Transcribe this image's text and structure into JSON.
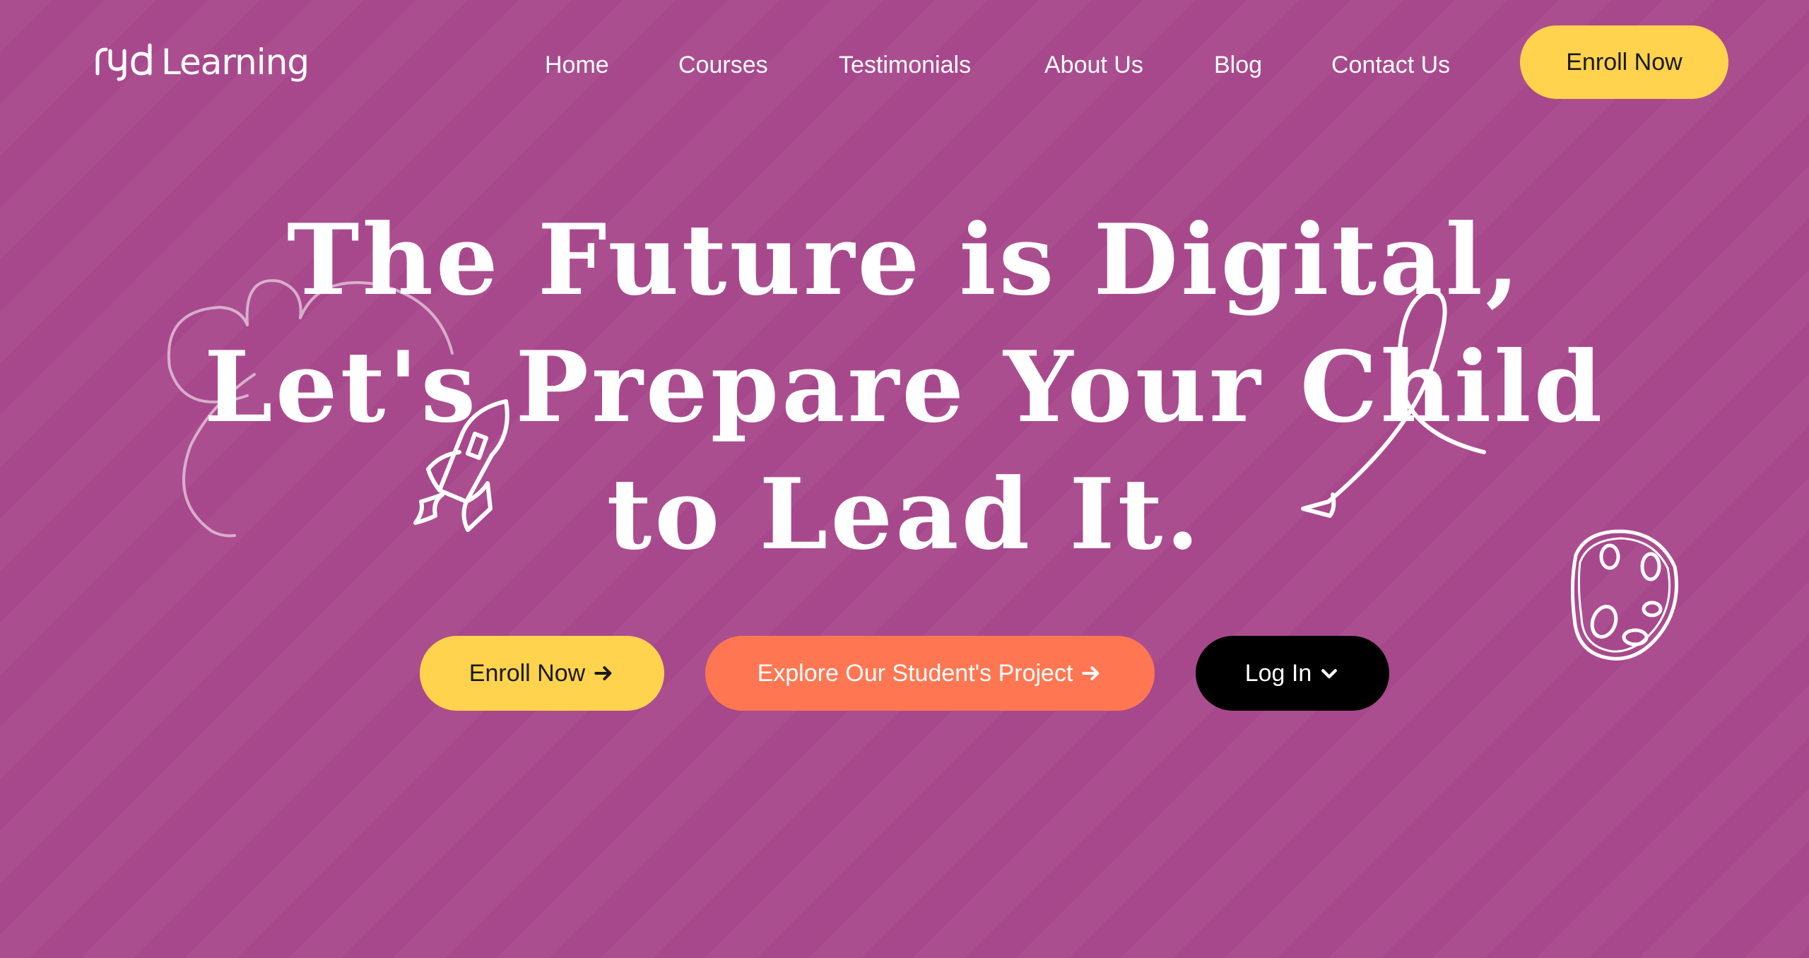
{
  "brand": {
    "name": "Learning",
    "logo_mark": "ryd-logo-mark"
  },
  "nav": {
    "items": [
      {
        "label": "Home"
      },
      {
        "label": "Courses"
      },
      {
        "label": "Testimonials"
      },
      {
        "label": "About Us"
      },
      {
        "label": "Blog"
      },
      {
        "label": "Contact Us"
      }
    ],
    "cta_label": "Enroll Now"
  },
  "hero": {
    "title_lines": [
      "The Future is Digital,",
      "Let's Prepare Your Child",
      "to Lead It."
    ],
    "buttons": {
      "enroll_label": "Enroll Now",
      "explore_label": "Explore Our Student's Project",
      "login_label": "Log In"
    }
  },
  "icons": {
    "arrow": "arrow-right-icon",
    "chevron": "chevron-down-icon",
    "rocket": "rocket-icon",
    "planet": "planet-icon",
    "cloud": "cloud-doodle",
    "curly_arrow": "curly-arrow-doodle"
  },
  "colors": {
    "background": "#a8488c",
    "primary_yellow": "#ffd34d",
    "accent_orange": "#ff7752",
    "login_black": "#000000",
    "text_white": "#ffffff",
    "text_dark": "#1a1a1a"
  }
}
